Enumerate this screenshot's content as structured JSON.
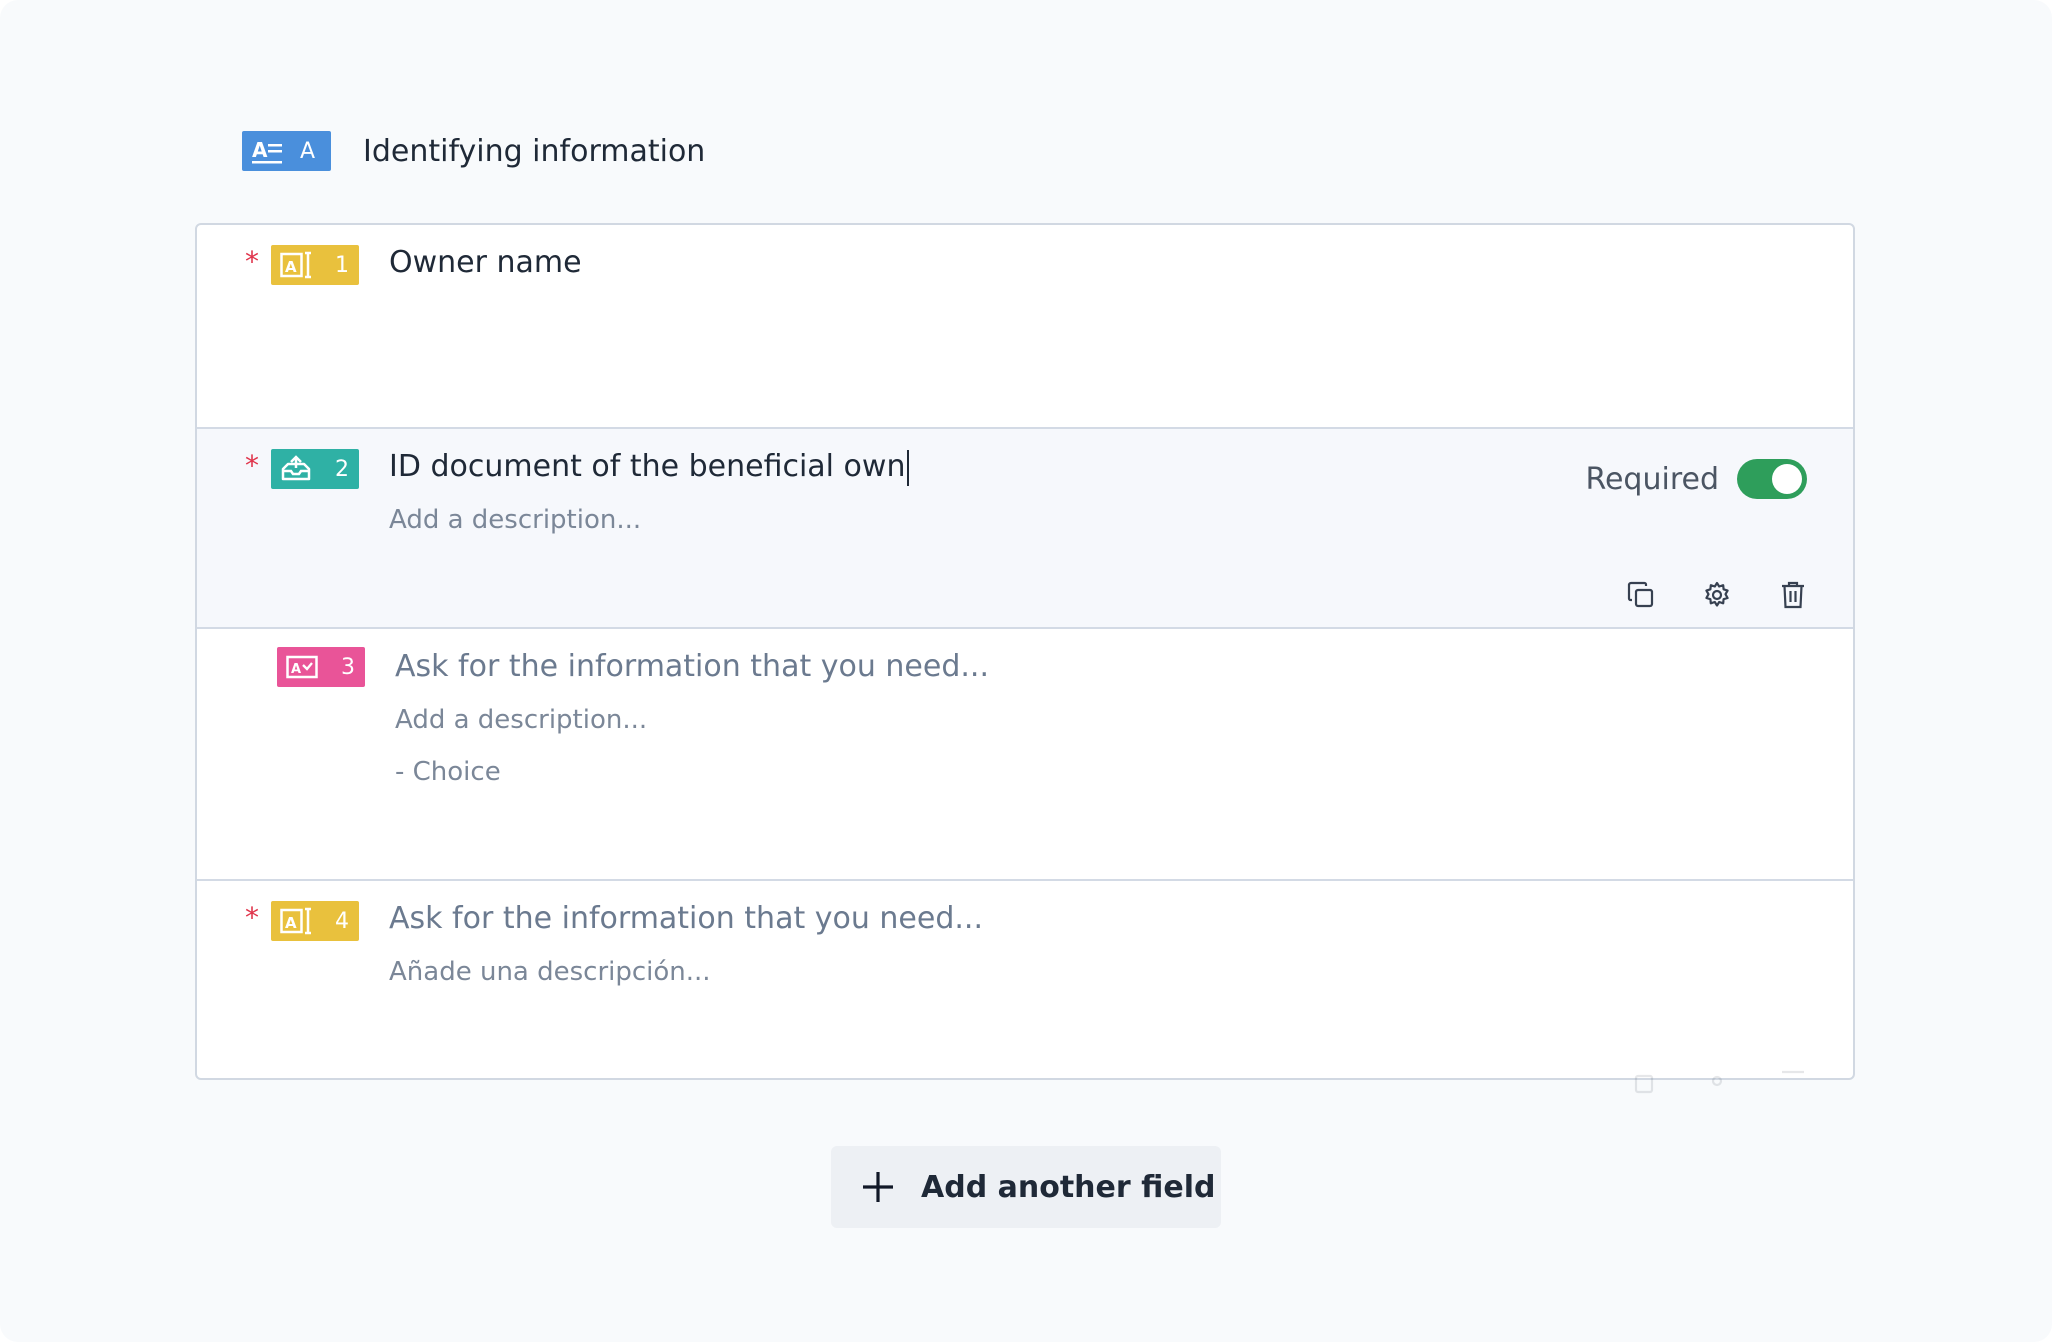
{
  "section": {
    "badge_letter": "A",
    "title": "Identifying information"
  },
  "fields": [
    {
      "number": "1",
      "required_mark": "*",
      "title": "Owner name",
      "type_icon": "text-field-icon",
      "color": "#e9c13d"
    },
    {
      "number": "2",
      "required_mark": "*",
      "title": "ID document of the beneficial own",
      "description": "Add a description...",
      "type_icon": "upload-tray-icon",
      "color": "#2fb1a5",
      "required_label": "Required",
      "required_on": true
    },
    {
      "number": "3",
      "title_placeholder": "Ask for the information that you need...",
      "description": "Add a description...",
      "choice": "- Choice",
      "type_icon": "choice-field-icon",
      "color": "#e95498"
    },
    {
      "number": "4",
      "required_mark": "*",
      "title_placeholder": "Ask for the information that you need...",
      "description": "Añade una descripción...",
      "type_icon": "text-field-icon",
      "color": "#e9c13d"
    }
  ],
  "add_field": {
    "label": "Add another field"
  },
  "colors": {
    "accent": "#4a8fdc",
    "toggle_on": "#2e9e5b",
    "required": "#e0344b"
  }
}
